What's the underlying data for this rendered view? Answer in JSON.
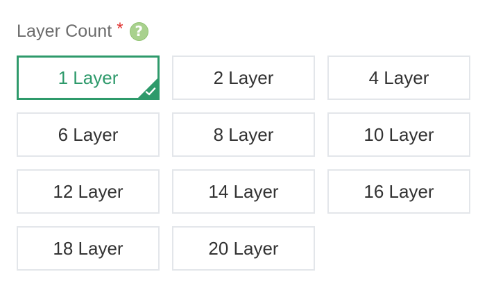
{
  "field": {
    "label": "Layer Count",
    "required_mark": "*",
    "help_icon_text": "?"
  },
  "options": [
    {
      "label": "1 Layer",
      "selected": true
    },
    {
      "label": "2 Layer",
      "selected": false
    },
    {
      "label": "4 Layer",
      "selected": false
    },
    {
      "label": "6 Layer",
      "selected": false
    },
    {
      "label": "8 Layer",
      "selected": false
    },
    {
      "label": "10 Layer",
      "selected": false
    },
    {
      "label": "12 Layer",
      "selected": false
    },
    {
      "label": "14 Layer",
      "selected": false
    },
    {
      "label": "16 Layer",
      "selected": false
    },
    {
      "label": "18 Layer",
      "selected": false
    },
    {
      "label": "20 Layer",
      "selected": false
    }
  ],
  "colors": {
    "accent": "#2e9a6b",
    "required": "#e0302e",
    "help_icon": "#a9d18e",
    "border": "#e3e6ea",
    "label_text": "#6b6b6b",
    "option_text": "#333333"
  },
  "icons": {
    "help": "question-circle-icon",
    "selected": "checkmark-icon"
  }
}
